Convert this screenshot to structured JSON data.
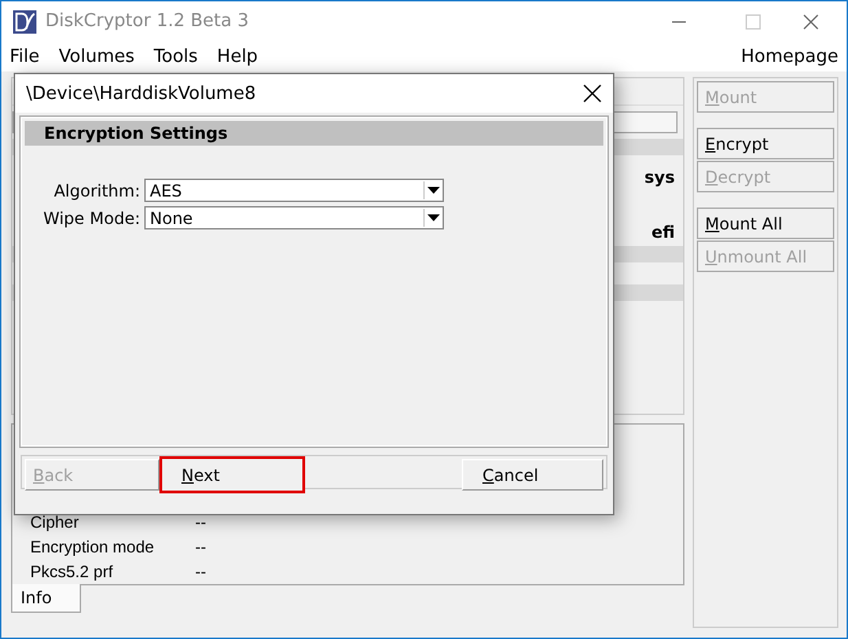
{
  "window": {
    "title": "DiskCryptor 1.2 Beta 3"
  },
  "menu": [
    "File",
    "Volumes",
    "Tools",
    "Help"
  ],
  "homepage_link": "Homepage",
  "volumes": [
    {
      "text": "sys"
    },
    {
      "text": "efi"
    }
  ],
  "actions": [
    {
      "label": "Mount",
      "disabled": true
    },
    {
      "label": "Encrypt",
      "disabled": false
    },
    {
      "label": "Decrypt",
      "disabled": true
    },
    {
      "label": "Mount All",
      "disabled": false
    },
    {
      "label": "Unmount All",
      "disabled": true
    }
  ],
  "info": [
    {
      "label": "Cipher",
      "value": "--"
    },
    {
      "label": "Encryption mode",
      "value": "--"
    },
    {
      "label": "Pkcs5.2 prf",
      "value": "--"
    }
  ],
  "tabs": [
    {
      "label": "Info",
      "selected": true
    }
  ],
  "dialog": {
    "title": "\\Device\\HarddiskVolume8",
    "section": "Encryption Settings",
    "fields": [
      {
        "label": "Algorithm:",
        "value": "AES"
      },
      {
        "label": "Wipe Mode:",
        "value": "None"
      }
    ],
    "buttons": [
      {
        "label": "Back",
        "disabled": true,
        "highlighted": false
      },
      {
        "label": "Next",
        "disabled": false,
        "highlighted": true
      },
      {
        "label": "Cancel",
        "disabled": false,
        "highlighted": false
      }
    ]
  }
}
